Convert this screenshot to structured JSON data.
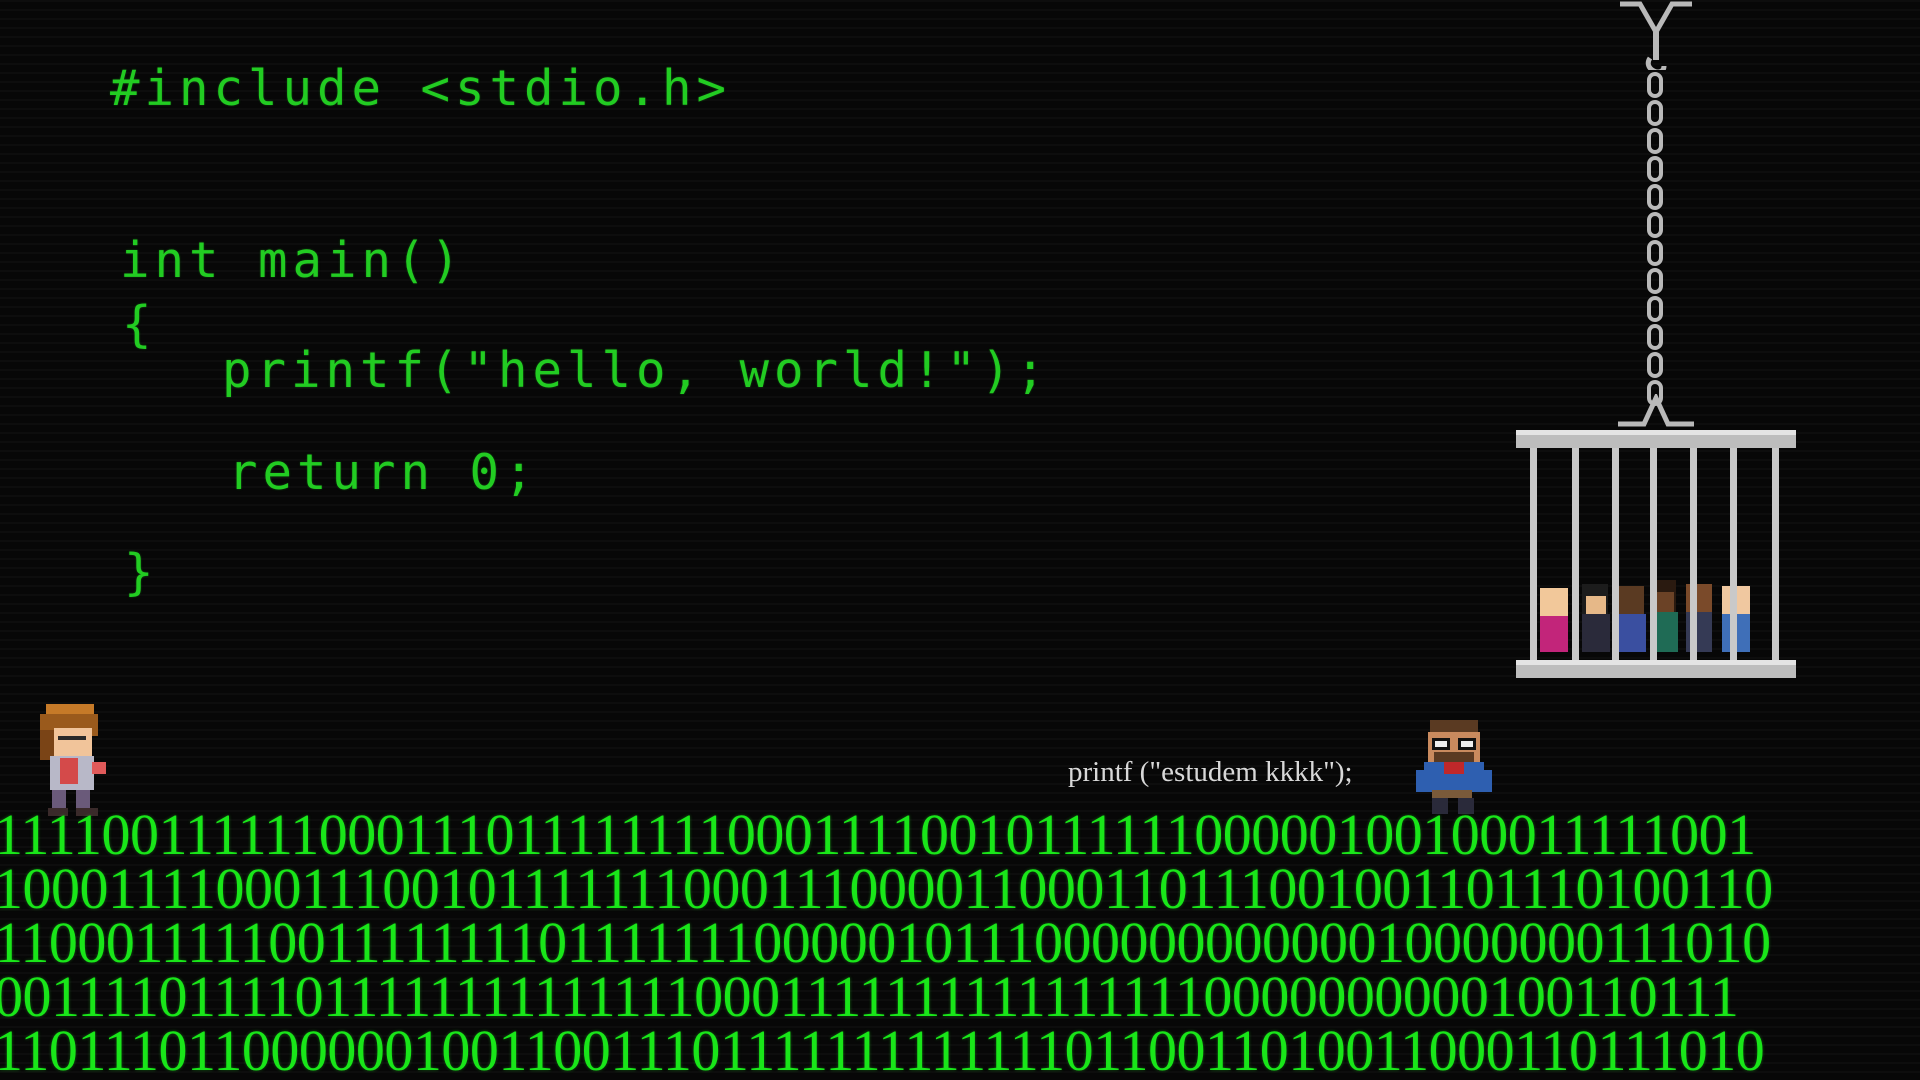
{
  "code": {
    "include_line": "#include <stdio.h>",
    "main_line": "int main()",
    "open_brace": "{",
    "printf_line": "printf(\"hello, world!\");",
    "return_line": "return 0;",
    "close_brace": "}"
  },
  "caption": "printf (\"estudem kkkk\");",
  "binary_rows": [
    "1111001111110001110111111110001111001011111100000100100011111001",
    "1000111100011100101111111000111000011000110111001001101110100110",
    "1100011111001111111101111111000001011100000000000010000000111010",
    "0011110111101111111111111100011111111111111110000000000100110111",
    "1101110110000001001100111011111111111110110011010011000110111010"
  ],
  "colors": {
    "code_green": "#22cc22",
    "binary_green": "#19e619",
    "background": "#070707",
    "cage_metal": "#b9b9b9",
    "caption_text": "#d8d8d8"
  },
  "sprites": {
    "hero": "player-character-sprite",
    "villain": "nerd-villain-sprite",
    "prisoners": "caged-students-sprite",
    "cage": "hanging-cage",
    "chain": "chain-icon"
  }
}
